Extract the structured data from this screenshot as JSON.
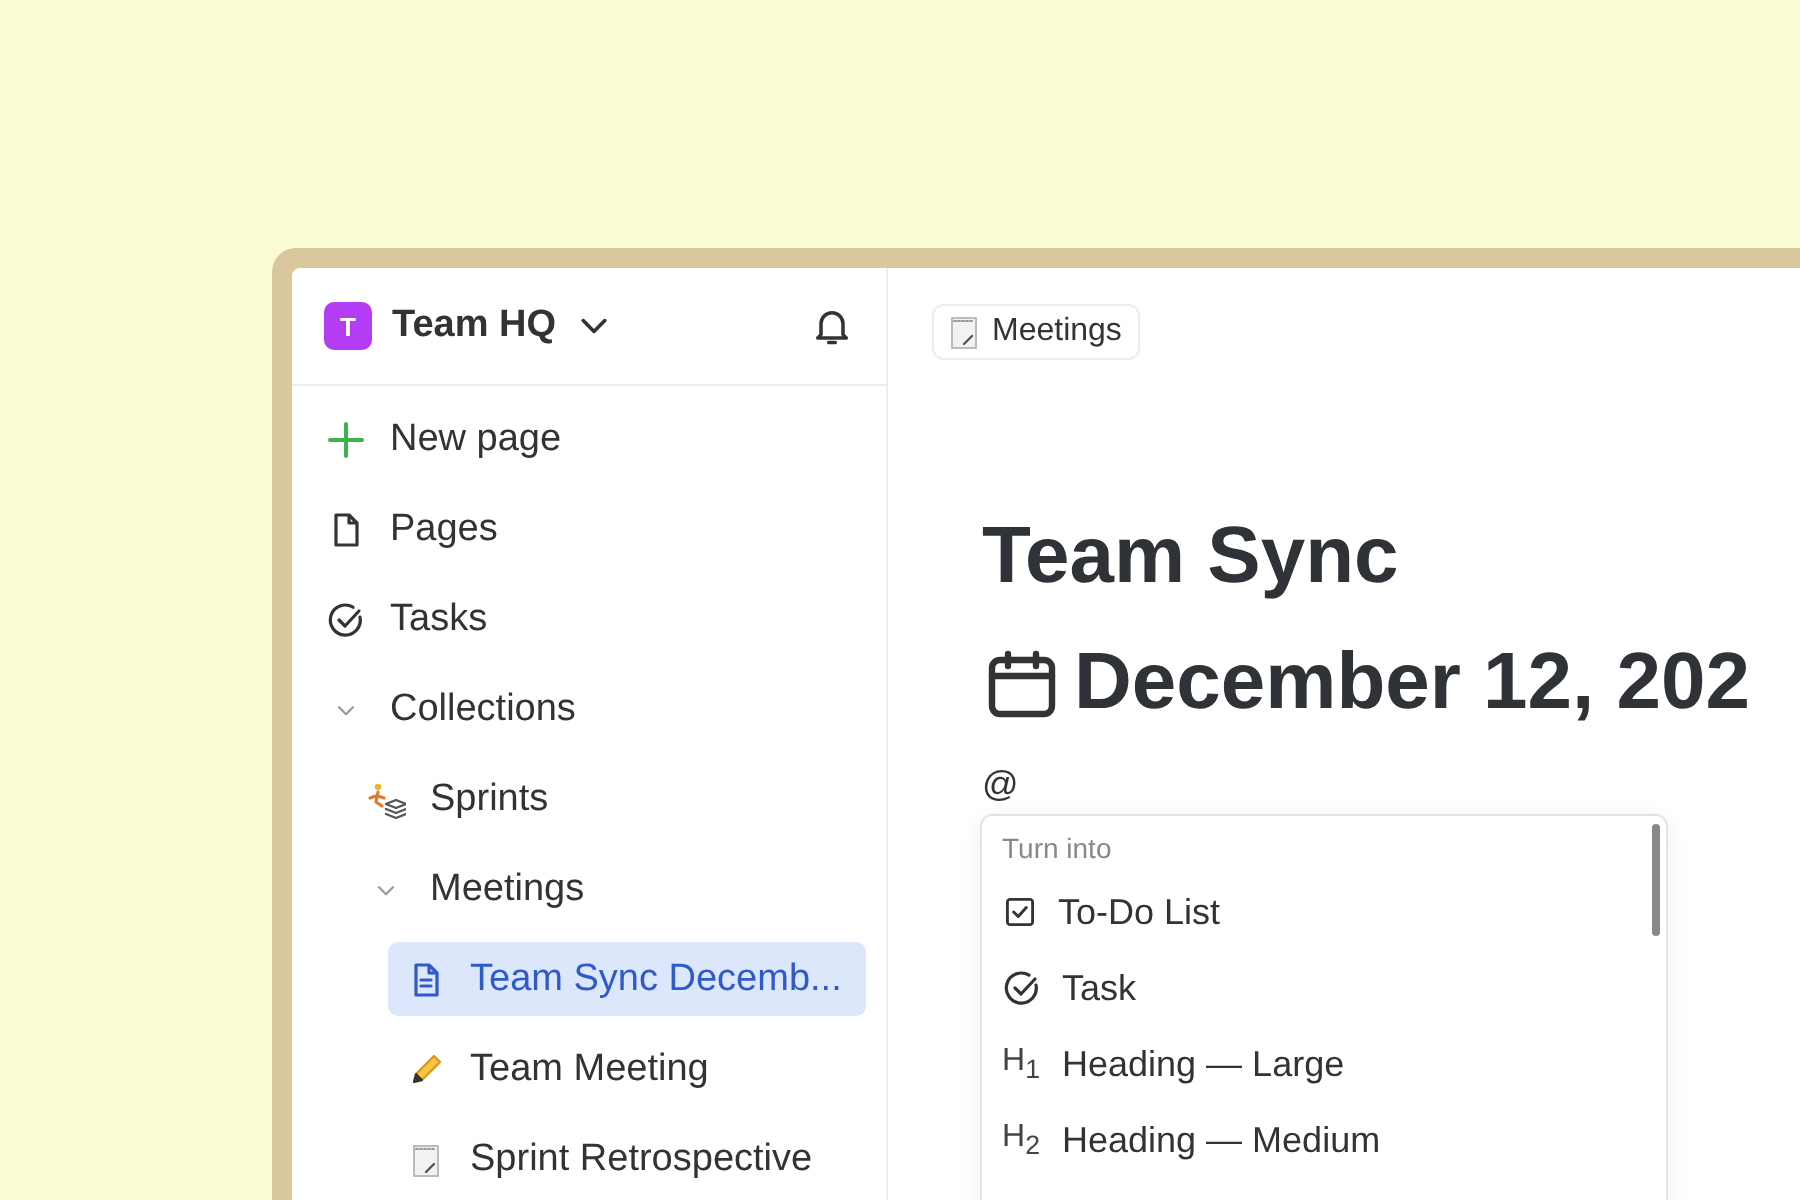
{
  "workspace": {
    "initial": "T",
    "name": "Team HQ"
  },
  "sidebar": {
    "items": [
      {
        "kind": "new",
        "label": "New page"
      },
      {
        "kind": "page",
        "label": "Pages"
      },
      {
        "kind": "task",
        "label": "Tasks"
      },
      {
        "kind": "group",
        "label": "Collections",
        "expanded": true,
        "children": [
          {
            "kind": "sprints",
            "label": "Sprints"
          },
          {
            "kind": "group",
            "label": "Meetings",
            "expanded": true,
            "children": [
              {
                "kind": "doc",
                "label": "Team Sync Decemb...",
                "selected": true
              },
              {
                "kind": "pencil",
                "label": "Team Meeting",
                "selected": false
              },
              {
                "kind": "notepad",
                "label": "Sprint Retrospective",
                "selected": false
              }
            ]
          }
        ]
      }
    ]
  },
  "breadcrumb": {
    "label": "Meetings"
  },
  "document": {
    "title": "Team Sync",
    "date": "December 12, 202",
    "typed": "@"
  },
  "menu": {
    "header": "Turn into",
    "items": [
      {
        "kind": "todo",
        "label": "To-Do List"
      },
      {
        "kind": "task",
        "label": "Task"
      },
      {
        "kind": "heading",
        "marker": "H$_{1}$",
        "label": "Heading — Large"
      },
      {
        "kind": "heading",
        "marker": "H$_{2}$",
        "label": "Heading — Medium"
      }
    ]
  }
}
